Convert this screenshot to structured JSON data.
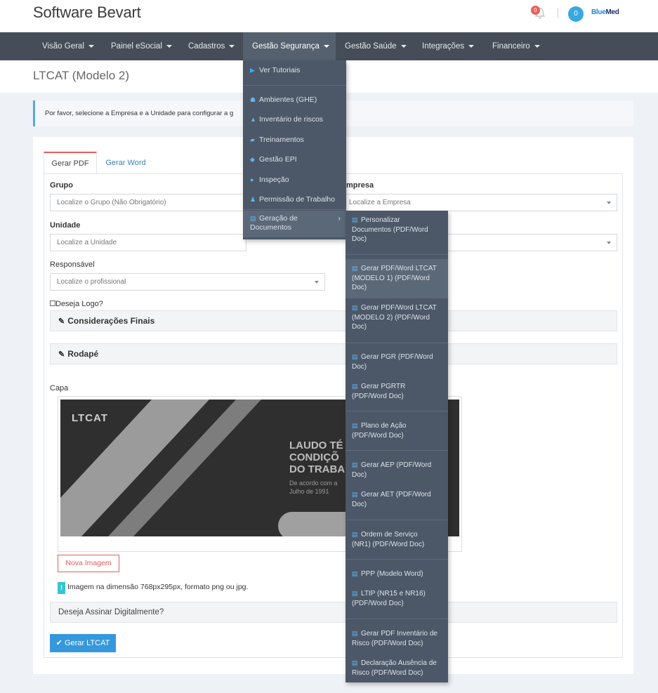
{
  "header": {
    "brand": "Software Bevart",
    "notification_count": "0",
    "user_count": "0",
    "logo_part1": "Blue",
    "logo_part2": "Med"
  },
  "nav": {
    "items": [
      {
        "label": "Visão Geral"
      },
      {
        "label": "Painel eSocial"
      },
      {
        "label": "Cadastros"
      },
      {
        "label": "Gestão Segurança"
      },
      {
        "label": "Gestão Saúde"
      },
      {
        "label": "Integrações"
      },
      {
        "label": "Financeiro"
      }
    ]
  },
  "page": {
    "title": "LTCAT (Modelo 2)",
    "alert": "Por favor, selecione a Empresa e a Unidade para configurar a g"
  },
  "tabs": {
    "pdf": "Gerar PDF",
    "word": "Gerar Word"
  },
  "form": {
    "grupo_label": "Grupo",
    "grupo_placeholder": "Localize o Grupo (Não Obrigatório)",
    "empresa_label": "mpresa",
    "empresa_placeholder": "Localize a Empresa",
    "unidade_label": "Unidade",
    "unidade_placeholder": "Localize a Unidade",
    "responsavel_label": "Responsável",
    "responsavel_placeholder": "Localize o profissional",
    "logo_checkbox": "Deseja Logo?",
    "consideracoes": "Considerações Finais",
    "rodape": "Rodapé",
    "capa_label": "Capa",
    "cover_logo": "LTCAT",
    "cover_line1": "LAUDO TÉ",
    "cover_line2": "CONDIÇÕ",
    "cover_line3": "DO TRABA",
    "cover_sub1": "De acordo com a",
    "cover_sub2": "Julho de 1991",
    "nova_imagem": "Nova Imagem",
    "info": "Imagem na dimensão 768px295px, formato png ou jpg.",
    "assinar": "Deseja Assinar Digitalmente?",
    "gerar": "Gerar LTCAT"
  },
  "menu_seguranca": [
    {
      "label": "Ver Tutoriais",
      "icon": "youtube-icon"
    },
    {
      "label": "Ambientes (GHE)",
      "icon": "sitemap-icon"
    },
    {
      "label": "Inventário de riscos",
      "icon": "warning-icon"
    },
    {
      "label": "Treinamentos",
      "icon": "book-icon"
    },
    {
      "label": "Gestão EPI",
      "icon": "shield-icon"
    },
    {
      "label": "Inspeção",
      "icon": "binoculars-icon"
    },
    {
      "label": "Permissão de Trabalho",
      "icon": "worker-icon"
    },
    {
      "label": "Geração de\nDocumentos",
      "icon": "file-pdf-icon"
    }
  ],
  "menu_documentos": [
    "Personalizar\nDocumentos (PDF/Word\nDoc)",
    "Gerar PDF/Word LTCAT\n(MODELO 1) (PDF/Word\nDoc)",
    "Gerar PDF/Word LTCAT\n(MODELO 2) (PDF/Word\nDoc)",
    "Gerar PGR (PDF/Word\nDoc)",
    "Gerar PGRTR\n(PDF/Word Doc)",
    "Plano de Ação\n(PDF/Word Doc)",
    "Gerar AEP (PDF/Word\nDoc)",
    "Gerar AET (PDF/Word\nDoc)",
    "Ordem de Serviço\n(NR1) (PDF/Word Doc)",
    "PPP (Modelo Word)",
    "LTIP (NR15 e NR16)\n(PDF/Word Doc)",
    "Gerar PDF Inventário de\nRisco (PDF/Word Doc)",
    "Declaração Ausência de\nRisco (PDF/Word Doc)"
  ]
}
